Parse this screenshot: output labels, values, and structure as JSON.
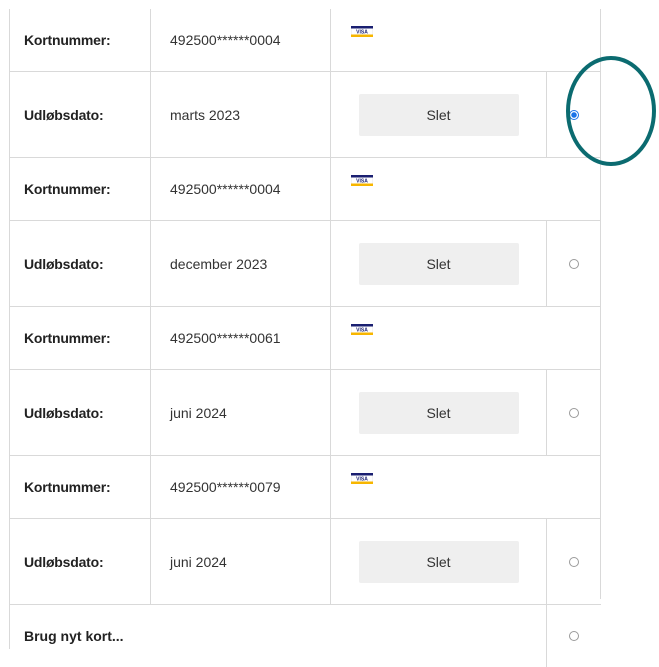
{
  "rows": [
    {
      "type": "card",
      "label": "Kortnummer:",
      "value": "492500******0004",
      "icon": "visa-icon"
    },
    {
      "type": "expiry",
      "label": "Udløbsdato:",
      "value": "marts 2023",
      "button": "Slet",
      "selected": true
    },
    {
      "type": "card",
      "label": "Kortnummer:",
      "value": "492500******0004",
      "icon": "visa-icon"
    },
    {
      "type": "expiry",
      "label": "Udløbsdato:",
      "value": "december 2023",
      "button": "Slet",
      "selected": false
    },
    {
      "type": "card",
      "label": "Kortnummer:",
      "value": "492500******0061",
      "icon": "visa-icon"
    },
    {
      "type": "expiry",
      "label": "Udløbsdato:",
      "value": "juni 2024",
      "button": "Slet",
      "selected": false
    },
    {
      "type": "card",
      "label": "Kortnummer:",
      "value": "492500******0079",
      "icon": "visa-icon"
    },
    {
      "type": "expiry",
      "label": "Udløbsdato:",
      "value": "juni 2024",
      "button": "Slet",
      "selected": false
    }
  ],
  "new_card": {
    "label": "Brug nyt kort...",
    "selected": false
  },
  "colors": {
    "visa_blue": "#1a1f71",
    "visa_gold": "#f7b600",
    "annotation": "#0b6b70",
    "radio_selected": "#1a73e8"
  }
}
